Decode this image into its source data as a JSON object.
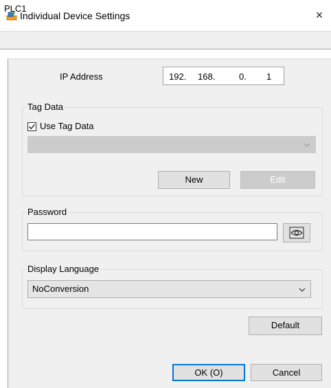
{
  "window": {
    "title": "Individual Device Settings",
    "close_symbol": "×"
  },
  "device": {
    "name": "PLC1"
  },
  "ip": {
    "label": "IP Address",
    "octets": [
      "192.",
      "168.",
      "0.",
      "1"
    ]
  },
  "tag_data": {
    "group_label": "Tag Data",
    "use_label": "Use Tag Data",
    "use_checked": true,
    "select_value": "",
    "new_label": "New",
    "edit_label": "Edit"
  },
  "password": {
    "group_label": "Password",
    "value": ""
  },
  "language": {
    "group_label": "Display Language",
    "value": "NoConversion"
  },
  "buttons": {
    "default_label": "Default",
    "ok_label": "OK (O)",
    "cancel_label": "Cancel"
  },
  "icons": {
    "app": "settings-device-icon",
    "eye": "eye-icon",
    "chevron": "chevron-down-icon",
    "check": "checkmark-icon"
  }
}
